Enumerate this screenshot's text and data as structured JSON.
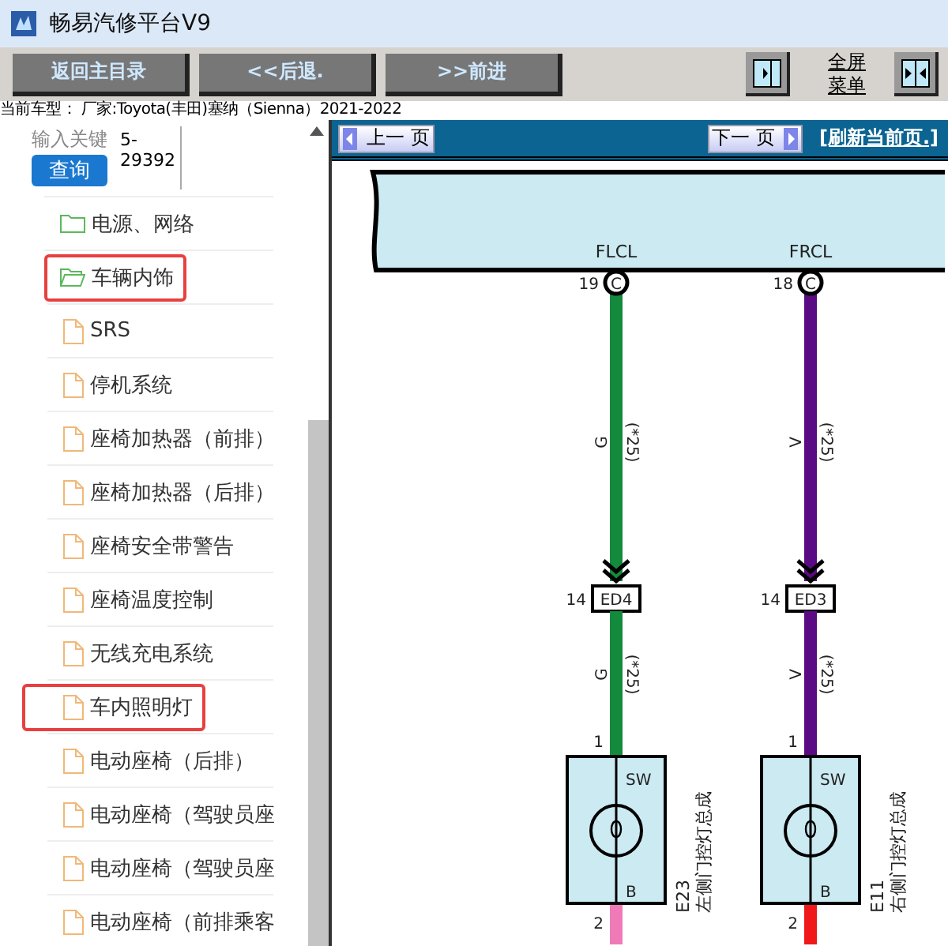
{
  "window": {
    "title": "畅易汽修平台V9"
  },
  "toolbar": {
    "buttons": [
      "返回主目录",
      "<<后退.",
      ">>前进"
    ],
    "fullscreen_menu": [
      "全屏",
      "菜单"
    ]
  },
  "car_model": "当前车型： 厂家:Toyota(丰田)塞纳（Sienna）2021-2022",
  "search": {
    "label": "输入关键",
    "value": "5-29392",
    "button": "查询"
  },
  "tree": [
    {
      "label": "电源、网络",
      "expanded": false,
      "highlighted": false
    },
    {
      "label": "车辆内饰",
      "expanded": true,
      "highlighted": true,
      "children": [
        {
          "label": "SRS",
          "highlighted": false
        },
        {
          "label": "停机系统",
          "highlighted": false
        },
        {
          "label": "座椅加热器（前排）",
          "highlighted": false
        },
        {
          "label": "座椅加热器（后排）",
          "highlighted": false
        },
        {
          "label": "座椅安全带警告",
          "highlighted": false
        },
        {
          "label": "座椅温度控制",
          "highlighted": false
        },
        {
          "label": "无线充电系统",
          "highlighted": false
        },
        {
          "label": "车内照明灯",
          "highlighted": true
        },
        {
          "label": "电动座椅（后排）",
          "highlighted": false
        },
        {
          "label": "电动座椅（驾驶员座",
          "highlighted": false
        },
        {
          "label": "电动座椅（驾驶员座",
          "highlighted": false
        },
        {
          "label": "电动座椅（前排乘客",
          "highlighted": false
        }
      ]
    }
  ],
  "nav": {
    "prev": "上一 页",
    "next": "下一 页",
    "refresh": "[刷新当前页.]"
  },
  "diagram": {
    "circuits": [
      {
        "pin_label": "FLCL",
        "pin": "19",
        "connector": "C",
        "wire_code": "G",
        "note": "(*25)",
        "junction_pin": "14",
        "junction": "ED4",
        "wire_code_2": "G",
        "note_2": "(*25)",
        "pin_in": "1",
        "top_terminal": "SW",
        "bottom_terminal": "B",
        "pin_out": "2",
        "component_id": "E23",
        "component_name": "左侧门控灯总成",
        "color": "#138a3c",
        "lower_wire": {
          "color": "#f07ab8"
        }
      },
      {
        "pin_label": "FRCL",
        "pin": "18",
        "connector": "C",
        "wire_code": "V",
        "note": "(*25)",
        "junction_pin": "14",
        "junction": "ED3",
        "wire_code_2": "V",
        "note_2": "(*25)",
        "pin_in": "1",
        "top_terminal": "SW",
        "bottom_terminal": "B",
        "pin_out": "2",
        "component_id": "E11",
        "component_name": "右侧门控灯总成",
        "color": "#5a0a82",
        "lower_wire": {
          "color": "#f01818"
        }
      }
    ]
  }
}
